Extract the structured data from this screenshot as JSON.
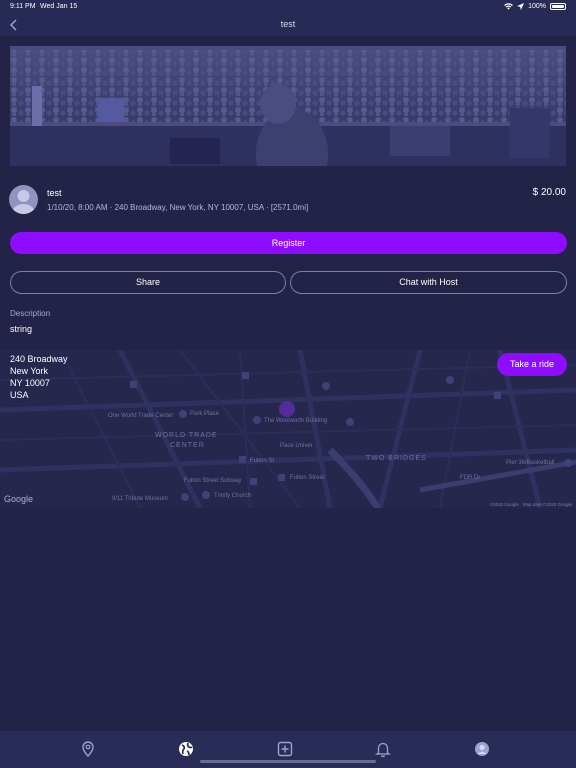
{
  "status_bar": {
    "time": "9:11 PM",
    "date": "Wed Jan 15",
    "battery": "100%"
  },
  "nav": {
    "title": "test"
  },
  "event": {
    "title": "test",
    "meta": "1/10/20, 8:00 AM · 240 Broadway, New York, NY 10007, USA · [2571.0mi]",
    "price": "$ 20.00"
  },
  "buttons": {
    "register": "Register",
    "share": "Share",
    "chat": "Chat with Host",
    "ride": "Take a ride"
  },
  "description": {
    "label": "Description",
    "text": "string"
  },
  "address": {
    "line1": "240 Broadway",
    "line2": "New York",
    "line3": "NY 10007",
    "line4": "USA"
  },
  "map": {
    "labels": {
      "wtc": "One World Trade Center",
      "park": "Park Place",
      "woolworth": "The Woolworth Building",
      "wtc_area1": "WORLD TRADE",
      "wtc_area2": "CENTER",
      "fulton": "Fulton St",
      "pace": "Pace Univer",
      "two_bridges": "TWO BRIDGES",
      "fulton_sub": "Fulton Street Subway",
      "fulton_street": "Fulton Street",
      "trinity": "Trinity Church",
      "memorial": "9/11 Tribute Museum",
      "fdr": "FDR Dr",
      "pier": "Pier 36/Basketball"
    },
    "google": "Google",
    "copyright": "©2020 Google · Map data ©2020 Google"
  },
  "tabs": [
    "location-pin-icon",
    "globe-icon",
    "add-icon",
    "bell-icon",
    "profile-icon"
  ],
  "colors": {
    "accent": "#8E0CFF",
    "background": "#222347"
  }
}
